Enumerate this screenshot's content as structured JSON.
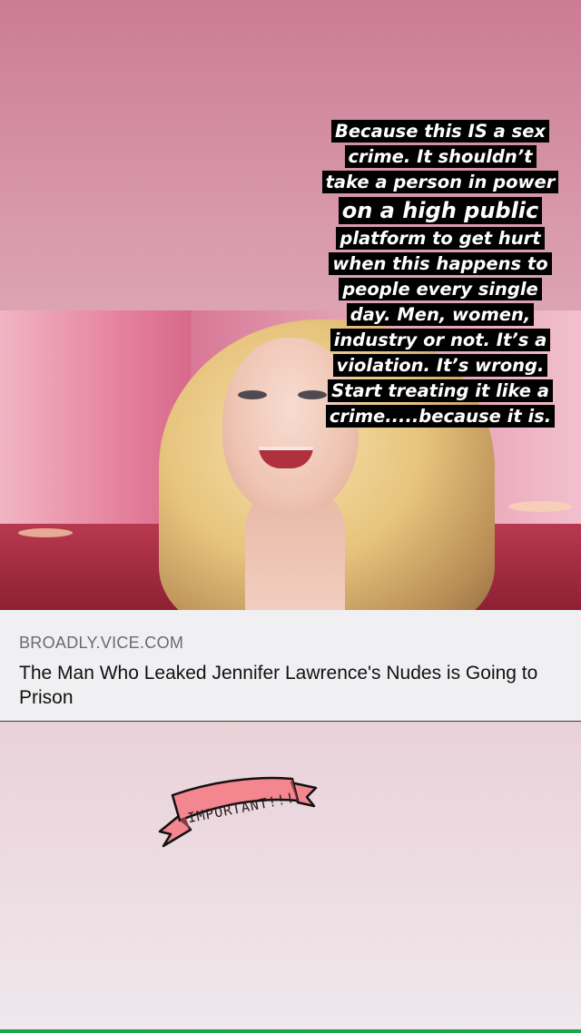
{
  "story": {
    "caption_lines": [
      "Because this IS a sex",
      "crime. It shouldn’t",
      "take a person in power",
      "on a high public",
      "platform to get hurt",
      "when this happens to",
      "people every single",
      "day. Men, women,",
      "industry or not. It’s a",
      "violation. It’s wrong.",
      "Start treating it like a",
      "crime.....because it is."
    ],
    "caption_colors": {
      "text": "#ffffff",
      "highlight": "#000000"
    }
  },
  "link_preview": {
    "domain": "BROADLY.VICE.COM",
    "title": "The Man Who Leaked Jennifer Lawrence's Nudes is Going to Prison"
  },
  "sticker": {
    "text": "IMPORTANT!!!",
    "fill_color": "#f3868f"
  },
  "colors": {
    "background_top": "#cb7c94",
    "background_bottom": "#efe8ec",
    "bottom_strip": "#1ea54a"
  }
}
